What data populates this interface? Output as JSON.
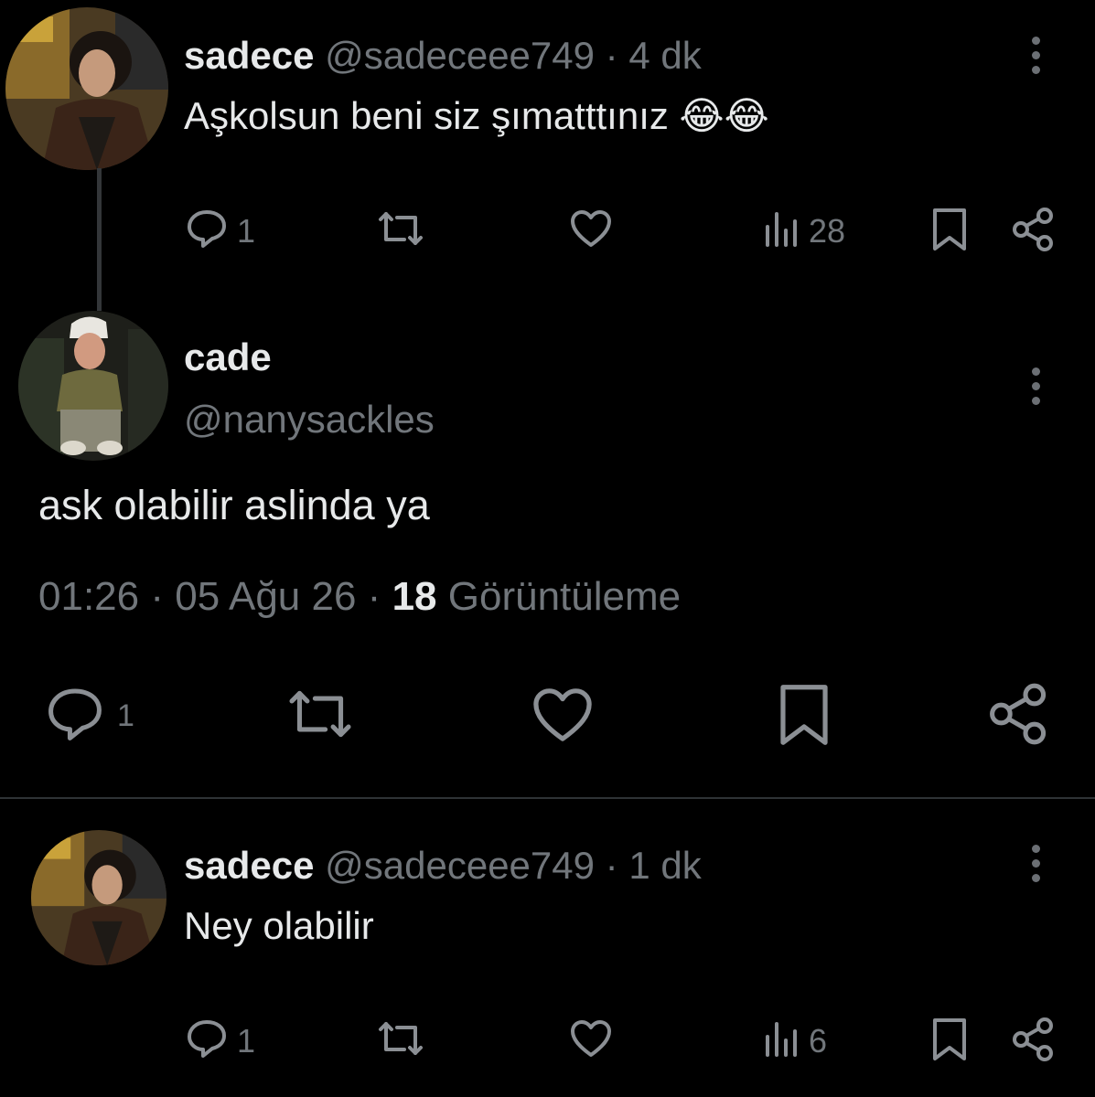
{
  "reply1": {
    "name": "sadece",
    "handle": "@sadeceee749",
    "separator": "·",
    "time": "4 dk",
    "text": "Aşkolsun beni siz şımatttınız 😂😂",
    "actions": {
      "reply_count": "1",
      "views_count": "28"
    }
  },
  "main": {
    "name": "cade",
    "handle": "@nanysackles",
    "text": "ask olabilir aslinda ya",
    "time": "01:26",
    "sep1": "·",
    "date": "05 Ağu 26",
    "sep2": "·",
    "views_number": "18",
    "views_label": "Görüntüleme",
    "actions": {
      "reply_count": "1"
    }
  },
  "reply2": {
    "name": "sadece",
    "handle": "@sadeceee749",
    "separator": "·",
    "time": "1 dk",
    "text": "Ney olabilir",
    "actions": {
      "reply_count": "1",
      "views_count": "6"
    }
  },
  "icons": [
    "reply-icon",
    "retweet-icon",
    "like-icon",
    "views-icon",
    "bookmark-icon",
    "share-icon",
    "more-icon"
  ],
  "colors": {
    "background": "#000000",
    "text": "#e7e9ea",
    "muted": "#71767b",
    "icon": "#8b8f94"
  }
}
